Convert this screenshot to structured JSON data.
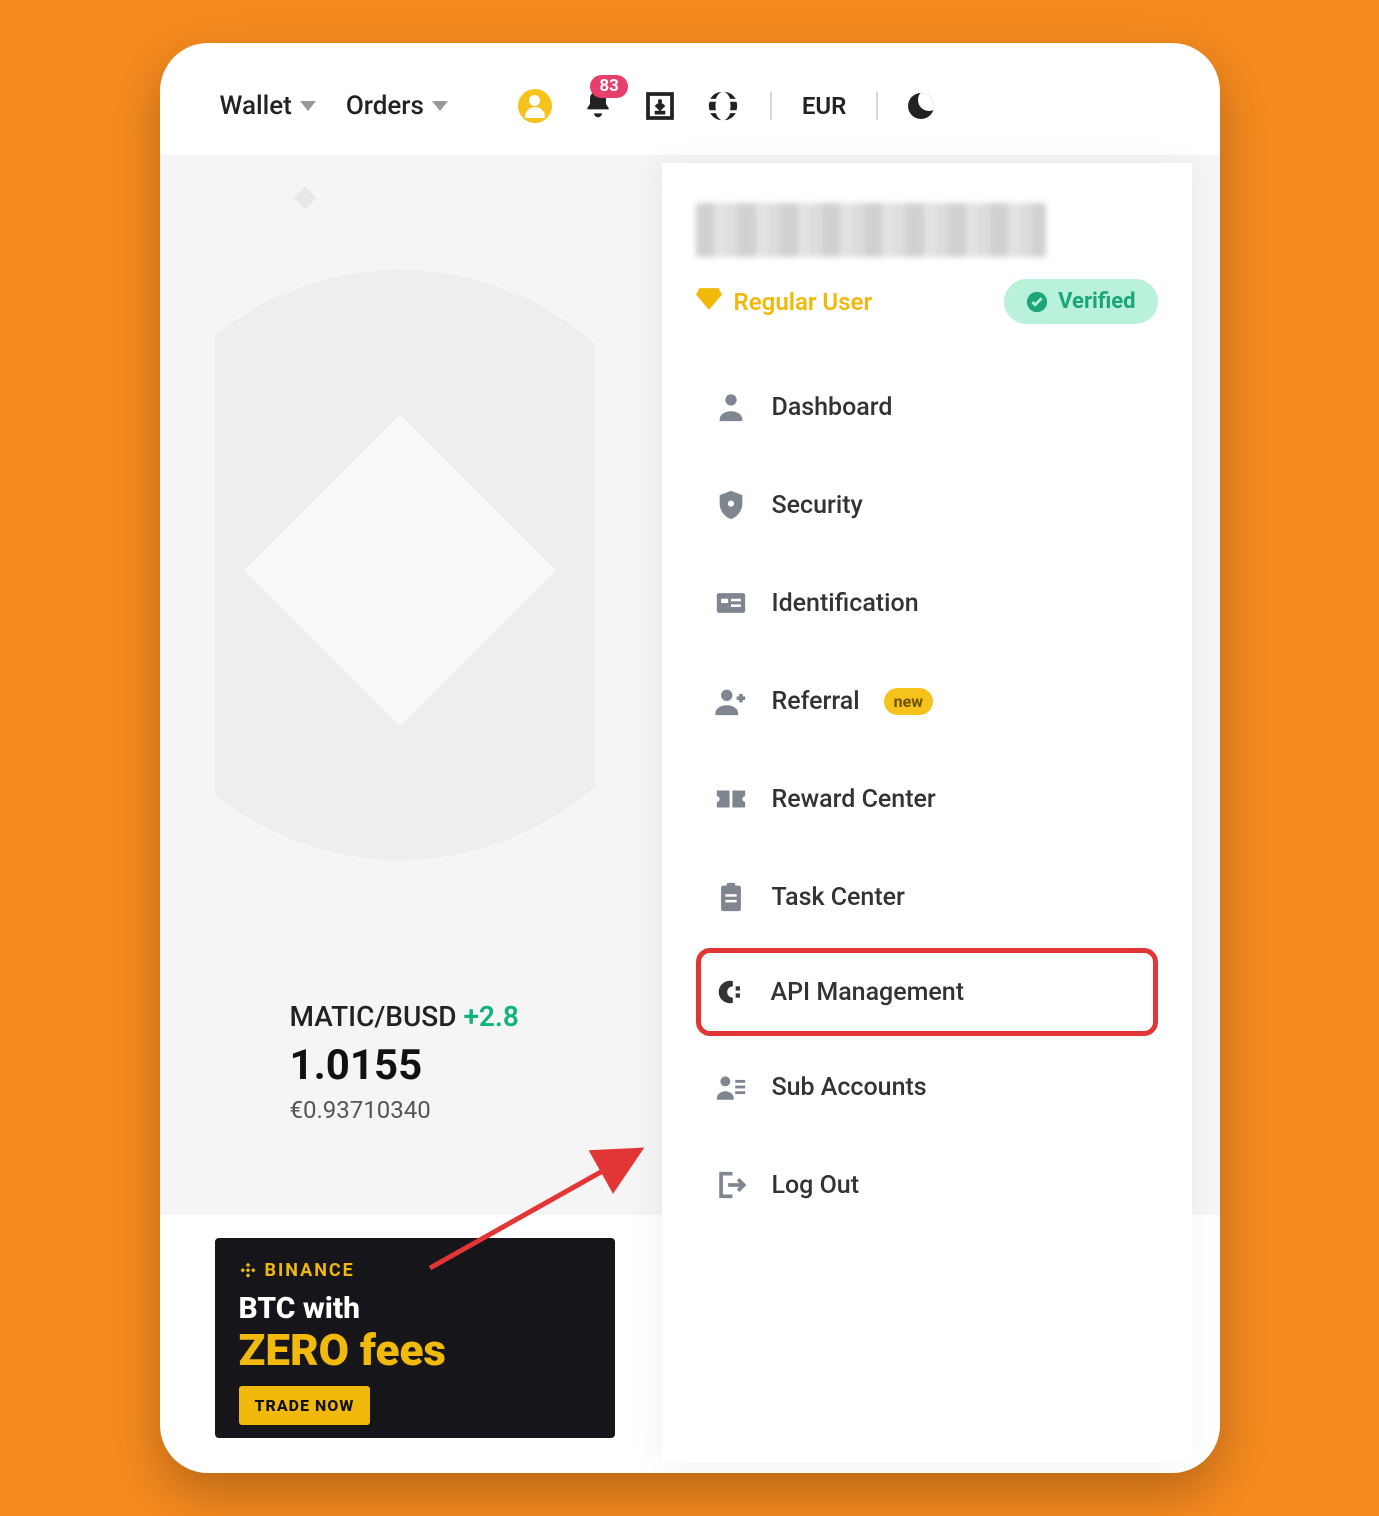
{
  "topnav": {
    "wallet_label": "Wallet",
    "orders_label": "Orders",
    "notification_count": "83",
    "currency": "EUR"
  },
  "ticker": {
    "pair": "MATIC/BUSD",
    "change": "+2.8",
    "price": "1.0155",
    "fiat": "€0.93710340"
  },
  "promo": {
    "brand": "BINANCE",
    "line1": "BTC with",
    "line2": "ZERO fees",
    "cta": "TRADE NOW"
  },
  "account": {
    "tier_label": "Regular User",
    "verified_label": "Verified"
  },
  "menu": {
    "dashboard": "Dashboard",
    "security": "Security",
    "identification": "Identification",
    "referral": "Referral",
    "referral_badge": "new",
    "reward_center": "Reward Center",
    "task_center": "Task Center",
    "api_management": "API Management",
    "sub_accounts": "Sub Accounts",
    "log_out": "Log Out"
  }
}
